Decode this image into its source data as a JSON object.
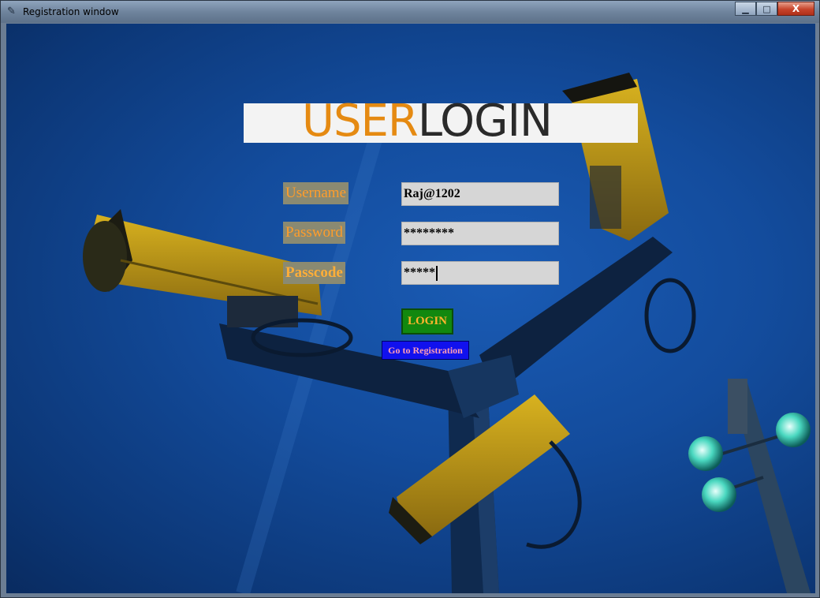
{
  "window": {
    "title": "Registration window",
    "controls": {
      "minimize": "▁",
      "maximize": "□",
      "close": "X"
    }
  },
  "heading": {
    "part1": "USER",
    "part2": "LOGIN"
  },
  "form": {
    "username_label": "Username",
    "username_value": "Raj@1202",
    "password_label": "Password",
    "password_value": "********",
    "passcode_label": "Passcode",
    "passcode_value": "*****"
  },
  "buttons": {
    "login": "LOGIN",
    "go_to_registration": "Go to Registration"
  },
  "colors": {
    "heading_user": "#e58a12",
    "heading_login": "#2a2a2a",
    "login_bg": "#12880f",
    "register_bg": "#1111ee"
  }
}
